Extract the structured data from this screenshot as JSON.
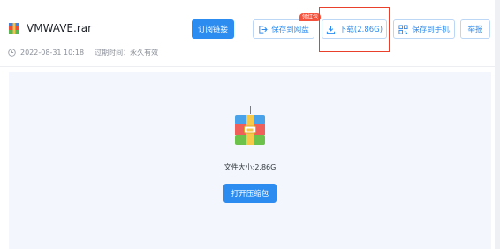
{
  "file": {
    "name": "VMWAVE.rar",
    "date": "2022-08-31 10:18",
    "expiry_label": "过期时间：",
    "expiry_value": "永久有效",
    "size_text": "文件大小:2.86G"
  },
  "toolbar": {
    "subscribe_label": "订阅链接",
    "save_disk_label": "保存到网盘",
    "save_disk_badge": "领红包",
    "download_label": "下载(2.86G)",
    "save_phone_label": "保存到手机",
    "report_label": "举报"
  },
  "preview": {
    "open_label": "打开压缩包"
  },
  "colors": {
    "accent": "#2d8cf0",
    "highlight": "#e8402b",
    "badge": "#f5533d"
  }
}
